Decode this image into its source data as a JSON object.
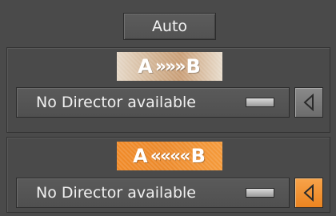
{
  "auto_button": {
    "label": "Auto"
  },
  "panels": [
    {
      "badge": {
        "from": "A",
        "arrows": "»»»",
        "to": "B",
        "style": "light"
      },
      "director": {
        "value": "No Director available"
      },
      "side_button": {
        "icon": "triangle-left-icon",
        "active": false
      }
    },
    {
      "badge": {
        "from": "A",
        "arrows": "««««",
        "to": "B",
        "style": "orange"
      },
      "director": {
        "value": "No Director available"
      },
      "side_button": {
        "icon": "triangle-left-icon",
        "active": true
      }
    }
  ],
  "colors": {
    "background": "#4a4a4a",
    "accent_orange": "#f28c28",
    "badge_light": "#d8b896"
  }
}
